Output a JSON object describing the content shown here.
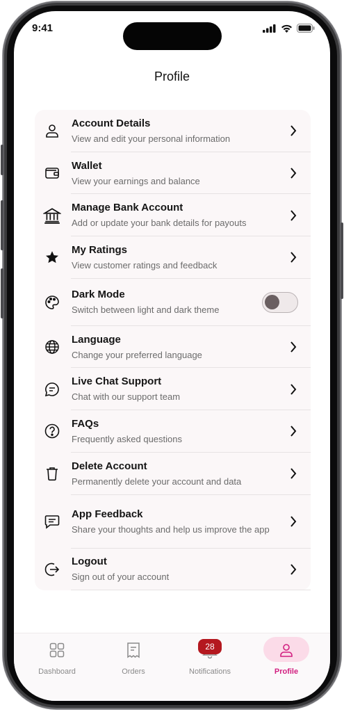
{
  "status": {
    "time": "9:41"
  },
  "header": {
    "title": "Profile"
  },
  "menu": [
    {
      "title": "Account Details",
      "subtitle": "View and edit your personal information",
      "icon": "user-icon"
    },
    {
      "title": "Wallet",
      "subtitle": "View your earnings and balance",
      "icon": "wallet-icon"
    },
    {
      "title": "Manage Bank Account",
      "subtitle": "Add or update your bank details for payouts",
      "icon": "bank-icon"
    },
    {
      "title": "My Ratings",
      "subtitle": "View customer ratings and feedback",
      "icon": "star-icon"
    },
    {
      "title": "Dark Mode",
      "subtitle": "Switch between light and dark theme",
      "icon": "palette-icon",
      "toggle": false
    },
    {
      "title": "Language",
      "subtitle": "Change your preferred language",
      "icon": "globe-icon"
    },
    {
      "title": "Live Chat Support",
      "subtitle": "Chat with our support team",
      "icon": "chat-icon"
    },
    {
      "title": "FAQs",
      "subtitle": "Frequently asked questions",
      "icon": "question-icon"
    },
    {
      "title": "Delete Account",
      "subtitle": "Permanently delete your account and data",
      "icon": "trash-icon"
    },
    {
      "title": "App Feedback",
      "subtitle": "Share your thoughts and help us improve the app",
      "icon": "feedback-icon"
    },
    {
      "title": "Logout",
      "subtitle": "Sign out of your account",
      "icon": "logout-icon"
    }
  ],
  "tabs": [
    {
      "label": "Dashboard",
      "icon": "grid-icon"
    },
    {
      "label": "Orders",
      "icon": "receipt-icon"
    },
    {
      "label": "Notifications",
      "icon": "bell-icon",
      "badge": "28"
    },
    {
      "label": "Profile",
      "icon": "profile-icon",
      "active": true
    }
  ],
  "colors": {
    "accent": "#d21f80",
    "accent_bg": "#fbdbe8",
    "badge": "#b4181f",
    "list_bg": "#fbf7f8"
  }
}
